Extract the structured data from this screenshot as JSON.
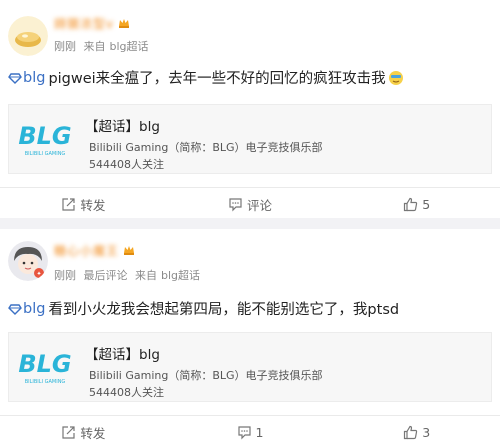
{
  "posts": [
    {
      "username": "鍀獳浓型v",
      "time": "刚刚",
      "source_prefix": "来自",
      "source": "blg超话",
      "topic": "blg",
      "text": "pigwei来全瘟了，去年一些不好的回忆的疯狂攻击我",
      "card": {
        "title": "【超话】blg",
        "subtitle": "Bilibili Gaming（简称：BLG）电子竞技俱乐部",
        "followers": "544408人关注",
        "logo_text": "BLG",
        "logo_subtext": "BILIBILI GAMING"
      },
      "actions": {
        "share": "转发",
        "comment": "评论",
        "like": "5"
      }
    },
    {
      "username": "糖心小魔王",
      "time": "刚刚",
      "meta_extra": "最后评论",
      "source_prefix": "来自",
      "source": "blg超话",
      "topic": "blg",
      "text": "看到小火龙我会想起第四局，能不能别选它了，我ptsd",
      "card": {
        "title": "【超话】blg",
        "subtitle": "Bilibili Gaming（简称：BLG）电子竞技俱乐部",
        "followers": "544408人关注",
        "logo_text": "BLG",
        "logo_subtext": "BILIBILI GAMING"
      },
      "actions": {
        "share": "转发",
        "comment": "1",
        "like": "3"
      }
    }
  ],
  "colors": {
    "link": "#3b70c4",
    "username": "#f18a1c",
    "logo": "#2ab4d8",
    "divider": "#f2f2f5"
  }
}
